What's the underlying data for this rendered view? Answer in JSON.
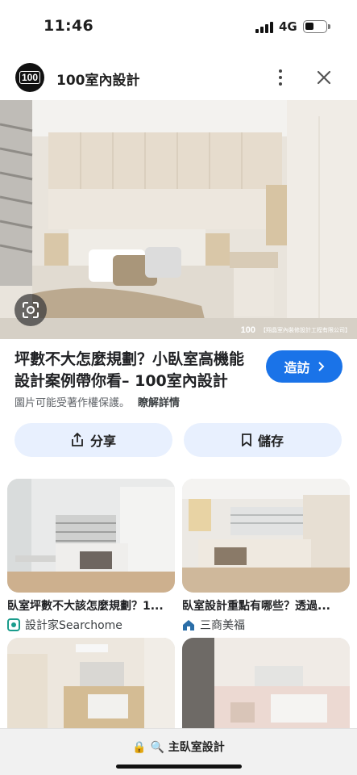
{
  "status_bar": {
    "time": "11:46",
    "network": "4G"
  },
  "header": {
    "site_name": "100室內設計",
    "logo_text": "100"
  },
  "hero": {
    "watermark_logo": "100",
    "watermark_text": "【翔晶室內裝修設計工程有限公司】"
  },
  "result": {
    "title": "坪數不大怎麼規劃？小臥室高機能設計案例帶你看– 100室內設計",
    "visit_label": "造訪",
    "copyright_notice": "圖片可能受著作權保護。",
    "learn_more": "瞭解詳情"
  },
  "actions": {
    "share_label": "分享",
    "save_label": "儲存"
  },
  "related": [
    {
      "caption": "臥室坪數不大該怎麼規劃？1...",
      "source": "設計家Searchome",
      "source_icon": "searchome-logo-icon"
    },
    {
      "caption": "臥室設計重點有哪些？透過...",
      "source": "三商美福",
      "source_icon": "house-logo-icon"
    },
    {
      "caption": "",
      "source": ""
    },
    {
      "caption": "",
      "source": ""
    }
  ],
  "bottom_bar": {
    "url": "🔒 🔍 主臥室設計"
  },
  "colors": {
    "accent": "#1a73e8",
    "button_bg": "#e8f0fe"
  }
}
